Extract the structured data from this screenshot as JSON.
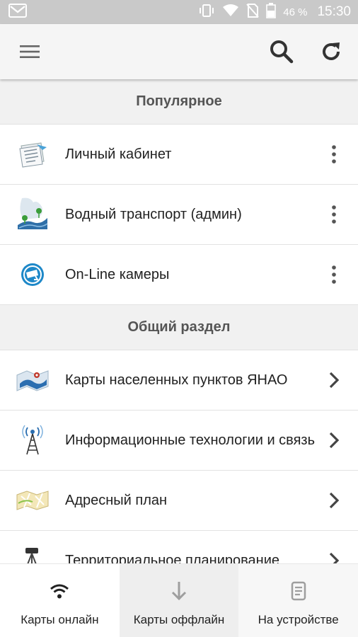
{
  "status_bar": {
    "battery": "46 %",
    "time": "15:30"
  },
  "toolbar": {
    "menu_icon": "hamburger-menu-icon",
    "search_icon": "search-icon",
    "refresh_icon": "refresh-icon"
  },
  "sections": [
    {
      "title": "Популярное",
      "items": [
        {
          "label": "Личный кабинет",
          "icon": "document-icon",
          "action": "more-vertical-icon"
        },
        {
          "label": "Водный транспорт (админ)",
          "icon": "water-transport-icon",
          "action": "more-vertical-icon"
        },
        {
          "label": "On-Line камеры",
          "icon": "camera-icon",
          "action": "more-vertical-icon"
        }
      ]
    },
    {
      "title": "Общий раздел",
      "items": [
        {
          "label": "Карты населенных пунктов ЯНАО",
          "icon": "map-icon",
          "action": "chevron-right-icon"
        },
        {
          "label": "Информационные технологии и связь",
          "icon": "antenna-icon",
          "action": "chevron-right-icon"
        },
        {
          "label": "Адресный план",
          "icon": "address-map-icon",
          "action": "chevron-right-icon"
        },
        {
          "label": "Территориальное планирование",
          "icon": "survey-tripod-icon",
          "action": "chevron-right-icon"
        }
      ]
    }
  ],
  "bottom_nav": [
    {
      "label": "Карты онлайн",
      "icon": "wifi-icon",
      "active": true
    },
    {
      "label": "Карты оффлайн",
      "icon": "download-icon",
      "active": false
    },
    {
      "label": "На устройстве",
      "icon": "device-icon",
      "active": false
    }
  ],
  "colors": {
    "status_bar": "#c9c9c9",
    "toolbar": "#f5f5f5",
    "section_header": "#f1f1f1",
    "camera_blue": "#1e88c8"
  }
}
